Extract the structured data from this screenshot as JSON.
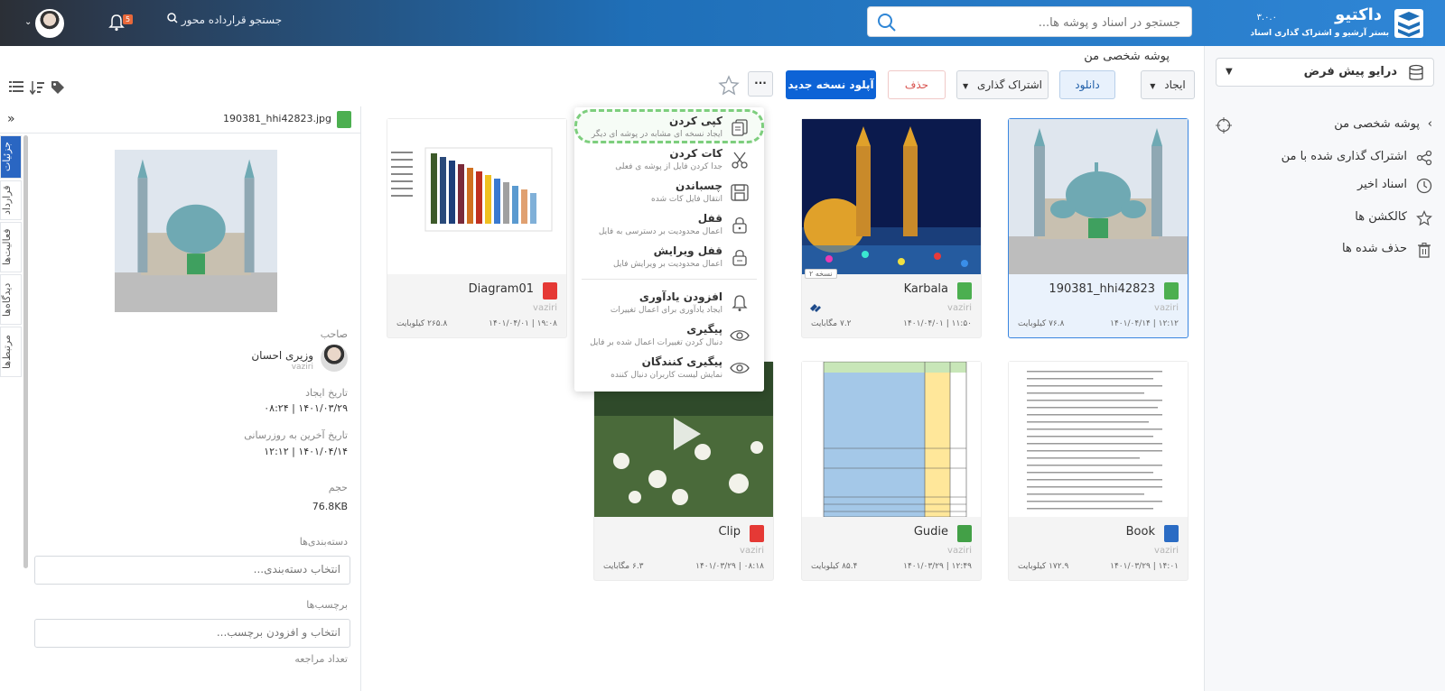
{
  "app": {
    "name": "داکتیو",
    "version": "۳.۰.۰",
    "subtitle": "بستر آرشیو و اشتراک گذاری اسناد"
  },
  "header": {
    "search_placeholder": "جستجو در اسناد و پوشه ها...",
    "contract_search": "جستجو قرارداده محور",
    "notification_count": "5"
  },
  "sidebar": {
    "drive": "درایو پیش فرض",
    "items": [
      {
        "label": "پوشه شخصی من",
        "icon": "folder-target-icon"
      },
      {
        "label": "اشتراک گذاری شده با من",
        "icon": "share-icon"
      },
      {
        "label": "اسناد اخیر",
        "icon": "clock-icon"
      },
      {
        "label": "کالکشن ها",
        "icon": "star-icon"
      },
      {
        "label": "حذف شده ها",
        "icon": "trash-icon"
      }
    ]
  },
  "path": "پوشه شخصی من",
  "toolbar": {
    "create": "ایجاد",
    "download": "دانلود",
    "share": "اشتراک گذاری",
    "delete": "حذف",
    "upload_new_version": "آپلود نسخه جدید",
    "more": "···"
  },
  "files": [
    {
      "name": "190381_hhi42823",
      "owner": "vaziri",
      "date": "۱۴۰۱/۰۴/۱۴ | ۱۲:۱۲",
      "size": "۷۶.۸ کیلوبایت",
      "type": "JPG"
    },
    {
      "name": "Karbala",
      "owner": "vaziri",
      "date": "۱۴۰۱/۰۴/۰۱ | ۱۱:۵۰",
      "size": "۷.۲ مگابایت",
      "type": "JPG",
      "version": "نسخه ۲"
    },
    {
      "name": "Diagram01",
      "owner": "vaziri",
      "date": "۱۴۰۱/۰۴/۰۱ | ۱۹:۰۸",
      "size": "۲۶۵.۸ کیلوبایت",
      "type": "PDF"
    },
    {
      "name": "Book",
      "owner": "vaziri",
      "date": "۱۴۰۱/۰۳/۲۹ | ۱۴:۰۱",
      "size": "۱۷۲.۹ کیلوبایت",
      "type": "DOC"
    },
    {
      "name": "Gudie",
      "owner": "vaziri",
      "date": "۱۴۰۱/۰۳/۲۹ | ۱۲:۴۹",
      "size": "۸۵.۴ کیلوبایت",
      "type": "XLS"
    },
    {
      "name": "Clip",
      "owner": "vaziri",
      "date": "۱۴۰۱/۰۳/۲۹ | ۰۸:۱۸",
      "size": "۶.۳ مگابایت",
      "type": "MP4"
    }
  ],
  "context_menu": [
    {
      "title": "کپی کردن",
      "desc": "ایجاد نسخه ای مشابه در پوشه ای دیگر",
      "icon": "copy-icon"
    },
    {
      "title": "کات کردن",
      "desc": "جدا کردن فایل از پوشه ی فعلی",
      "icon": "scissors-icon"
    },
    {
      "title": "چسباندن",
      "desc": "انتقال فایل کات شده",
      "icon": "paste-icon"
    },
    {
      "title": "قفل",
      "desc": "اعمال محدودیت بر دسترسی به فایل",
      "icon": "lock-icon"
    },
    {
      "title": "قفل ویرایش",
      "desc": "اعمال محدودیت بر ویرایش فایل",
      "icon": "edit-lock-icon"
    },
    {
      "title": "افزودن یادآوری",
      "desc": "ایجاد یادآوری برای اعمال تغییرات",
      "icon": "bell-icon"
    },
    {
      "title": "پیگیری",
      "desc": "دنبال کردن تغییرات اعمال شده بر فایل",
      "icon": "eye-icon"
    },
    {
      "title": "پیگیری کنندگان",
      "desc": "نمایش لیست کاربران دنبال کننده",
      "icon": "eye-icon"
    }
  ],
  "details": {
    "filename": "190381_hhi42823.jpg",
    "tabs": [
      "جزئیات",
      "قرارداد",
      "فعالیت‌ها",
      "دیدگاه‌ها",
      "مرتبط‌ها"
    ],
    "owner_label": "صاحب",
    "owner_name": "وزیری احسان",
    "owner_user": "vaziri",
    "created_label": "تاریخ ایجاد",
    "created_value": "۱۴۰۱/۰۳/۲۹ | ۰۸:۲۴",
    "updated_label": "تاریخ آخرین به روزرسانی",
    "updated_value": "۱۴۰۱/۰۴/۱۴ | ۱۲:۱۲",
    "size_label": "حجم",
    "size_value": "76.8KB",
    "category_label": "دسته‌بندی‌ها",
    "category_placeholder": "انتخاب دسته‌بندی...",
    "tags_label": "برچسب‌ها",
    "tags_placeholder": "انتخاب و افزودن برچسب...",
    "refs_label": "تعداد مراجعه"
  },
  "colors": {
    "primary": "#0d63d6",
    "header_dark": "#2b2f36",
    "header_blue": "#2f86d6",
    "highlight_green": "#7dce7d"
  }
}
